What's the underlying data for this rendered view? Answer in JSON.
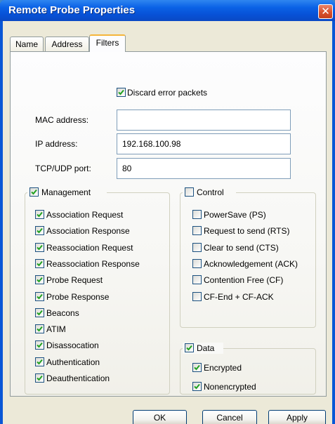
{
  "window": {
    "title": "Remote Probe Properties"
  },
  "tabs": [
    {
      "label": "Name"
    },
    {
      "label": "Address"
    },
    {
      "label": "Filters"
    }
  ],
  "filters": {
    "discard_error_packets": {
      "label": "Discard error packets",
      "checked": true
    },
    "mac_address": {
      "label": "MAC address:",
      "value": ""
    },
    "ip_address": {
      "label": "IP address:",
      "value": "192.168.100.98"
    },
    "port": {
      "label": "TCP/UDP port:",
      "value": "80"
    }
  },
  "management": {
    "title": "Management",
    "checked": true,
    "items": [
      {
        "label": "Association Request",
        "checked": true
      },
      {
        "label": "Association Response",
        "checked": true
      },
      {
        "label": "Reassociation Request",
        "checked": true
      },
      {
        "label": "Reassociation Response",
        "checked": true
      },
      {
        "label": "Probe Request",
        "checked": true
      },
      {
        "label": "Probe Response",
        "checked": true
      },
      {
        "label": "Beacons",
        "checked": true
      },
      {
        "label": "ATIM",
        "checked": true
      },
      {
        "label": "Disassocation",
        "checked": true
      },
      {
        "label": "Authentication",
        "checked": true
      },
      {
        "label": "Deauthentication",
        "checked": true
      }
    ]
  },
  "control": {
    "title": "Control",
    "checked": false,
    "items": [
      {
        "label": "PowerSave (PS)",
        "checked": false
      },
      {
        "label": "Request to send (RTS)",
        "checked": false
      },
      {
        "label": "Clear to send (CTS)",
        "checked": false
      },
      {
        "label": "Acknowledgement (ACK)",
        "checked": false
      },
      {
        "label": "Contention Free (CF)",
        "checked": false
      },
      {
        "label": "CF-End + CF-ACK",
        "checked": false
      }
    ]
  },
  "data_group": {
    "title": "Data",
    "checked": true,
    "items": [
      {
        "label": "Encrypted",
        "checked": true
      },
      {
        "label": "Nonencrypted",
        "checked": true
      }
    ]
  },
  "buttons": {
    "ok": "OK",
    "cancel": "Cancel",
    "apply": "Apply"
  },
  "icons": {
    "close": "close-icon",
    "check": "checkmark-icon"
  },
  "colors": {
    "titlebar": "#0751d6",
    "dialog_face": "#ece9d8",
    "checkmark": "#21a121",
    "close_button": "#d8502d",
    "active_tab_accent": "#f5b53a"
  }
}
